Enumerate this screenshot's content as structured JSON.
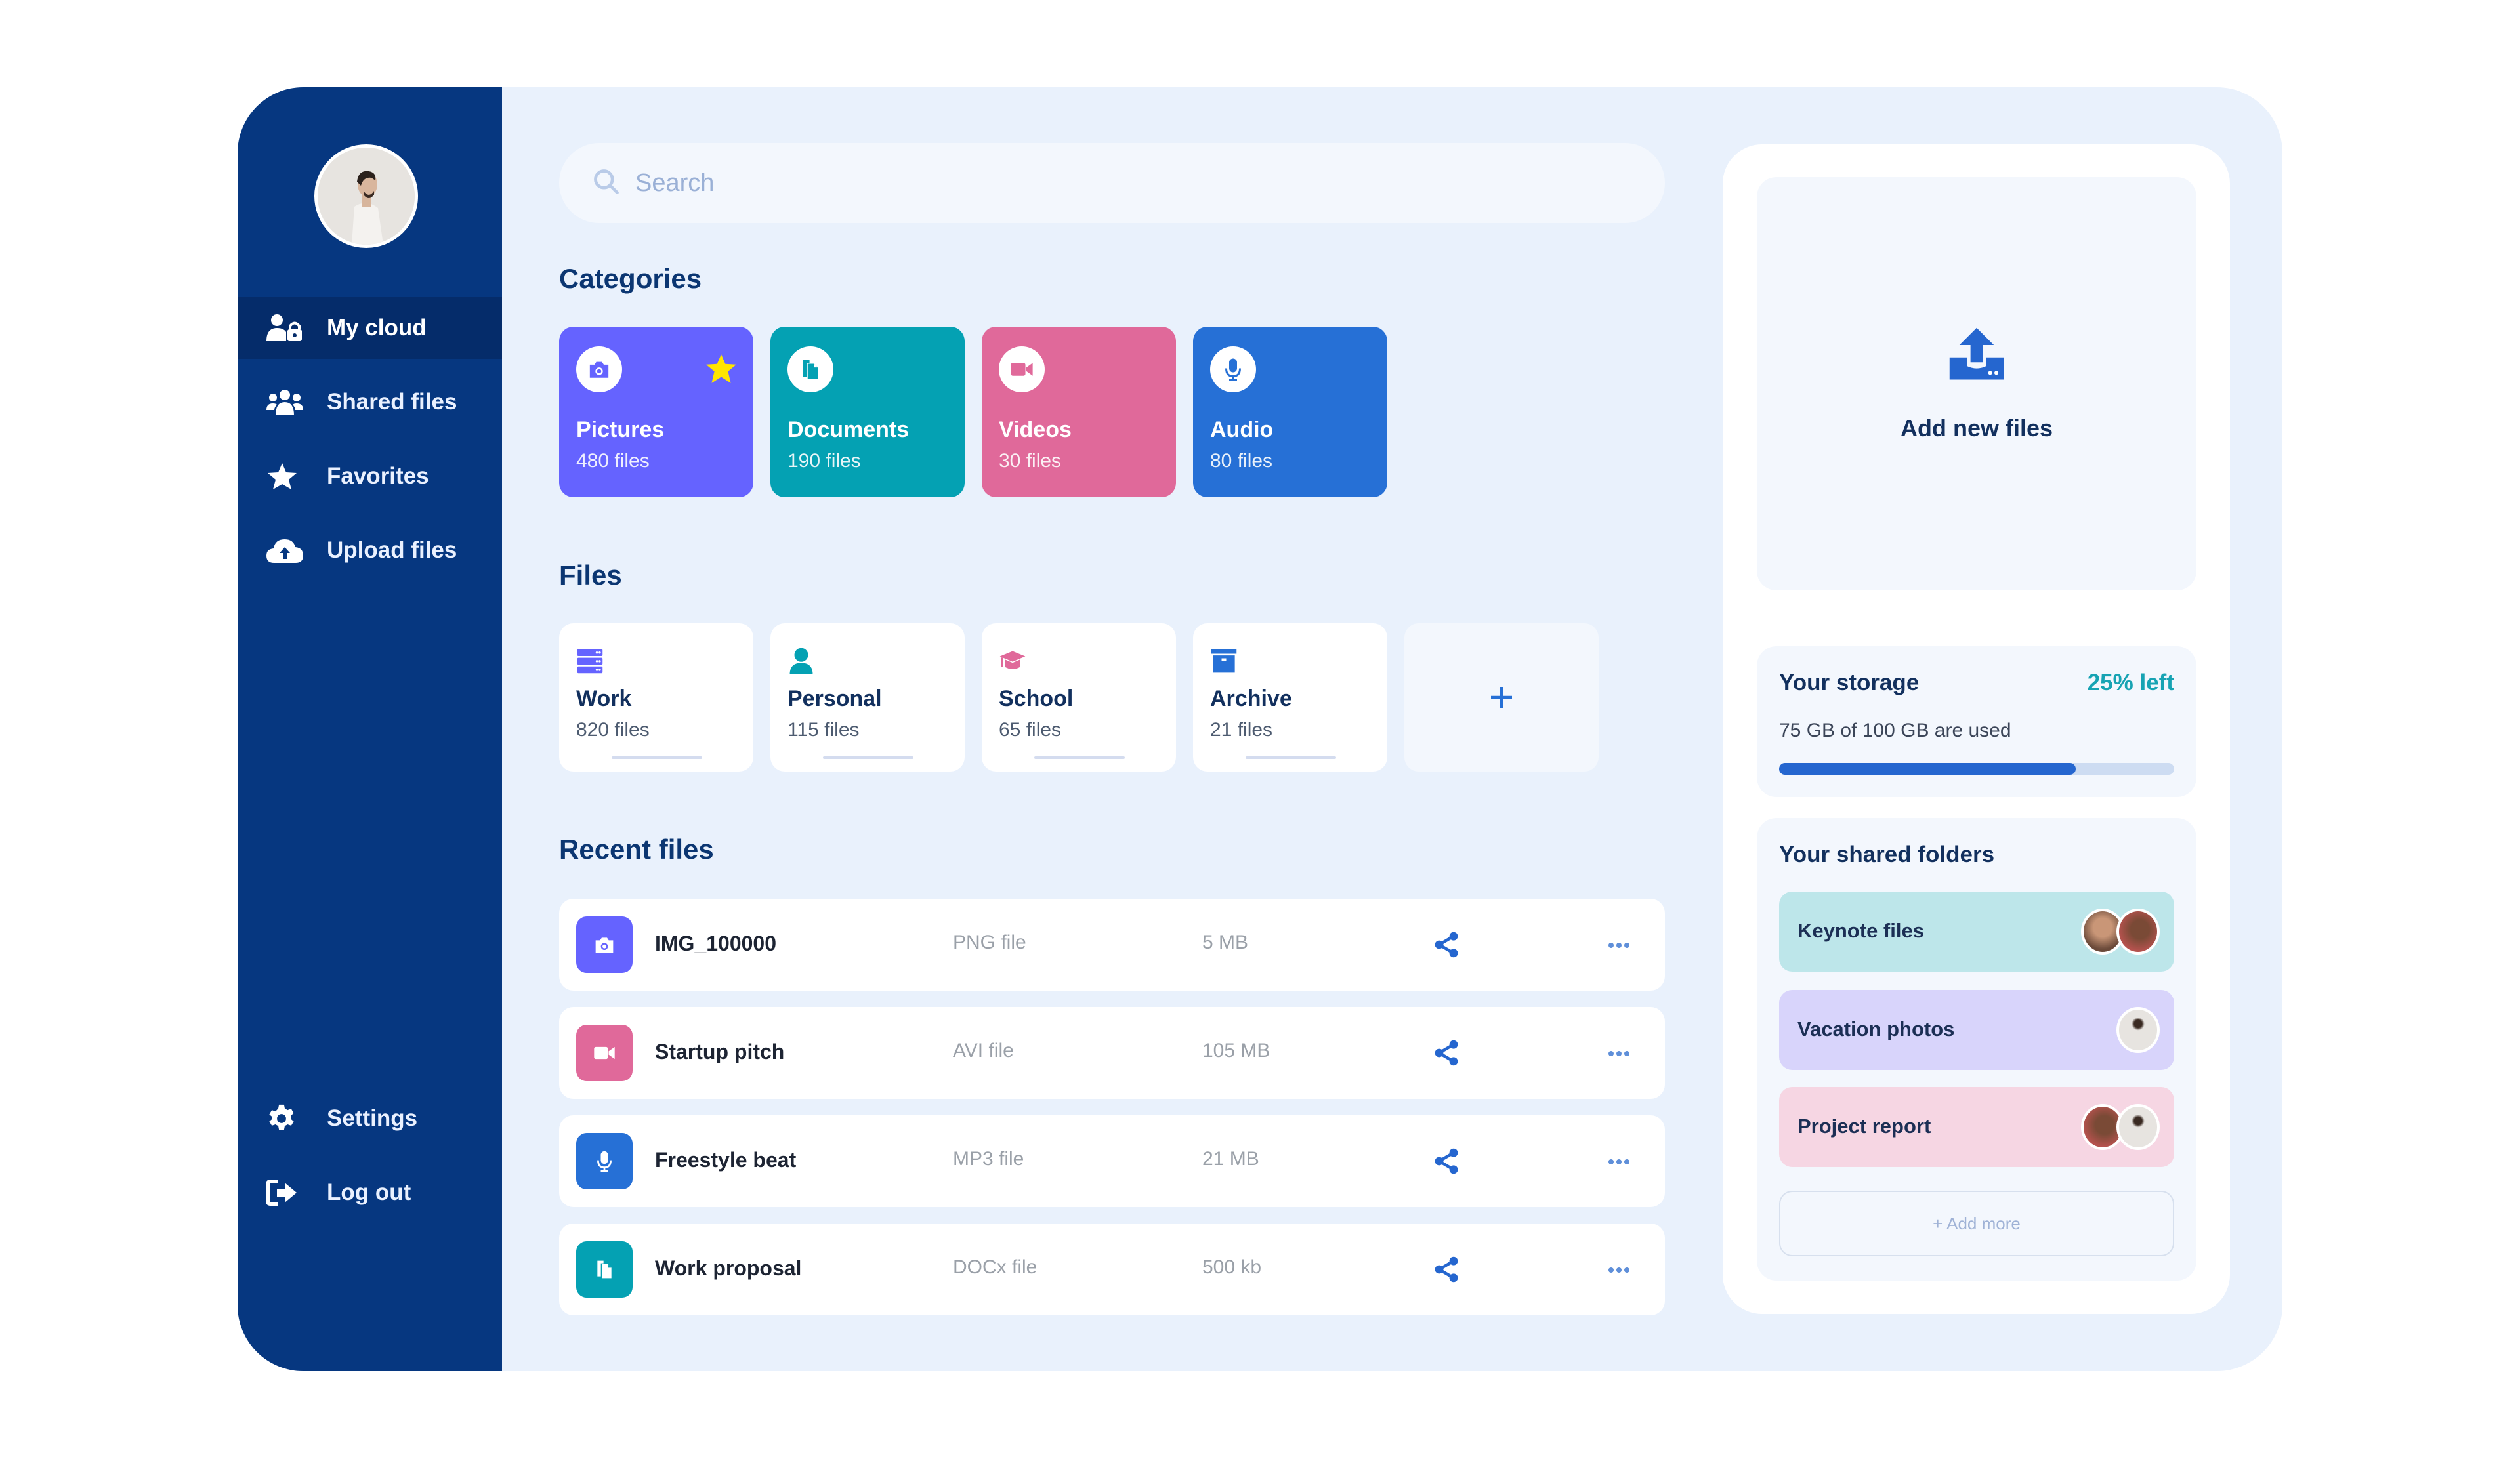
{
  "sidebar": {
    "items": [
      {
        "label": "My cloud",
        "icon": "user-lock-icon",
        "active": true
      },
      {
        "label": "Shared files",
        "icon": "users-icon",
        "active": false
      },
      {
        "label": "Favorites",
        "icon": "star-icon",
        "active": false
      },
      {
        "label": "Upload files",
        "icon": "cloud-upload-icon",
        "active": false
      }
    ],
    "bottom_items": [
      {
        "label": "Settings",
        "icon": "gear-icon"
      },
      {
        "label": "Log out",
        "icon": "logout-icon"
      }
    ]
  },
  "search": {
    "placeholder": "Search"
  },
  "categories": {
    "title": "Categories",
    "items": [
      {
        "name": "Pictures",
        "count": "480 files",
        "icon": "camera-icon",
        "color": "#6563ff",
        "favorite": true
      },
      {
        "name": "Documents",
        "count": "190 files",
        "icon": "documents-icon",
        "color": "#04a1b3",
        "favorite": false
      },
      {
        "name": "Videos",
        "count": "30 files",
        "icon": "video-camera-icon",
        "color": "#e0699a",
        "favorite": false
      },
      {
        "name": "Audio",
        "count": "80 files",
        "icon": "microphone-icon",
        "color": "#2670d6",
        "favorite": false
      }
    ]
  },
  "files": {
    "title": "Files",
    "items": [
      {
        "name": "Work",
        "count": "820 files",
        "icon": "server-icon",
        "color": "#6563ff"
      },
      {
        "name": "Personal",
        "count": "115 files",
        "icon": "user-icon",
        "color": "#04a1b3"
      },
      {
        "name": "School",
        "count": "65 files",
        "icon": "graduation-cap-icon",
        "color": "#e0699a"
      },
      {
        "name": "Archive",
        "count": "21 files",
        "icon": "archive-box-icon",
        "color": "#2670d6"
      }
    ],
    "add_label": "+"
  },
  "recent": {
    "title": "Recent files",
    "rows": [
      {
        "name": "IMG_100000",
        "type": "PNG file",
        "size": "5 MB",
        "icon": "camera-icon",
        "color": "#6563ff"
      },
      {
        "name": "Startup pitch",
        "type": "AVI file",
        "size": "105 MB",
        "icon": "video-camera-icon",
        "color": "#e0699a"
      },
      {
        "name": "Freestyle beat",
        "type": "MP3 file",
        "size": "21 MB",
        "icon": "microphone-icon",
        "color": "#2670d6"
      },
      {
        "name": "Work proposal",
        "type": "DOCx file",
        "size": "500 kb",
        "icon": "documents-icon",
        "color": "#04a1b3"
      }
    ]
  },
  "upload": {
    "label": "Add new files"
  },
  "storage": {
    "title": "Your storage",
    "left_label": "25% left",
    "used_label": "75 GB of 100 GB are used",
    "used_fraction": 0.75
  },
  "shared_folders": {
    "title": "Your shared folders",
    "items": [
      {
        "name": "Keynote files",
        "bg": "#bde6ea",
        "members": 2
      },
      {
        "name": "Vacation photos",
        "bg": "#d8d4fb",
        "members": 1
      },
      {
        "name": "Project report",
        "bg": "#f6d6e3",
        "members": 2
      }
    ],
    "add_more_label": "+ Add more"
  },
  "colors": {
    "sidebar": "#063780",
    "sidebar_active": "#052c6a",
    "accent": "#2566cf",
    "heading": "#0b3672",
    "teal": "#17a3b3"
  }
}
